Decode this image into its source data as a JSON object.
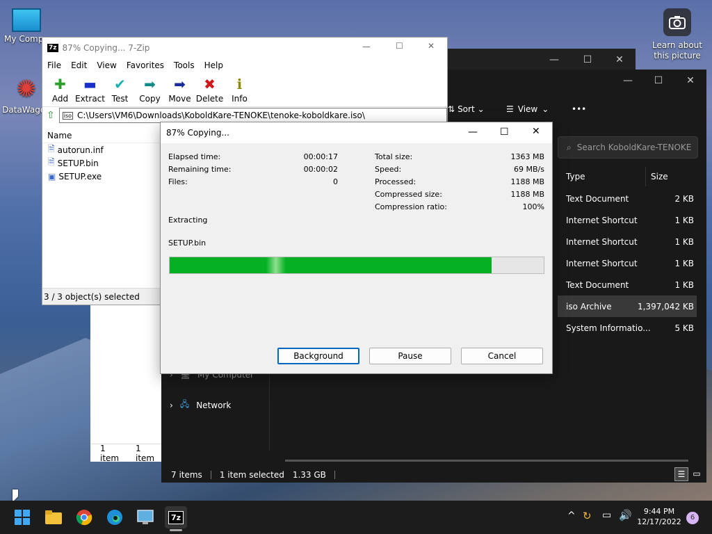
{
  "desktop": {
    "icons": [
      {
        "label": "My Compu"
      },
      {
        "label": "DataWagon"
      }
    ],
    "camera": {
      "label": "Learn about this picture"
    }
  },
  "zip": {
    "title": "87% Copying... 7-Zip",
    "menu": [
      "File",
      "Edit",
      "View",
      "Favorites",
      "Tools",
      "Help"
    ],
    "toolbar": [
      {
        "label": "Add",
        "glyph": "✚",
        "color": "#2aa02a"
      },
      {
        "label": "Extract",
        "glyph": "▬",
        "color": "#1a2fc8"
      },
      {
        "label": "Test",
        "glyph": "✔",
        "color": "#16b0b0"
      },
      {
        "label": "Copy",
        "glyph": "➡",
        "color": "#138a8a"
      },
      {
        "label": "Move",
        "glyph": "➡",
        "color": "#1a2a9a"
      },
      {
        "label": "Delete",
        "glyph": "✖",
        "color": "#d0181c"
      },
      {
        "label": "Info",
        "glyph": "ℹ",
        "color": "#8a8a00"
      }
    ],
    "address": "C:\\Users\\VM6\\Downloads\\KoboldKare-TENOKE\\tenoke-koboldkare.iso\\",
    "column_name": "Name",
    "files": [
      "autorun.inf",
      "SETUP.bin",
      "SETUP.exe"
    ],
    "status": "3 / 3 object(s) selected"
  },
  "dialog": {
    "title": "87% Copying...",
    "left": [
      {
        "label": "Elapsed time:",
        "value": "00:00:17"
      },
      {
        "label": "Remaining time:",
        "value": "00:00:02"
      },
      {
        "label": "Files:",
        "value": "0"
      }
    ],
    "right": [
      {
        "label": "Total size:",
        "value": "1363 MB"
      },
      {
        "label": "Speed:",
        "value": "69 MB/s"
      },
      {
        "label": "Processed:",
        "value": "1188 MB"
      },
      {
        "label": "Compressed size:",
        "value": "1188 MB"
      },
      {
        "label": "Compression ratio:",
        "value": "100%"
      }
    ],
    "operation": "Extracting",
    "current_file": "SETUP.bin",
    "progress": 0.86,
    "buttons": {
      "background": "Background",
      "pause": "Pause",
      "cancel": "Cancel"
    }
  },
  "explorer": {
    "sort": "Sort",
    "view": "View",
    "more": "•••",
    "search_placeholder": "Search KoboldKare-TENOKE",
    "col_type": "Type",
    "col_size": "Size",
    "rows": [
      {
        "type": "Text Document",
        "size": "2 KB"
      },
      {
        "type": "Internet Shortcut",
        "size": "1 KB"
      },
      {
        "type": "Internet Shortcut",
        "size": "1 KB"
      },
      {
        "type": "Internet Shortcut",
        "size": "1 KB"
      },
      {
        "type": "Text Document",
        "size": "1 KB"
      },
      {
        "type": "iso Archive",
        "size": "1,397,042 KB"
      },
      {
        "type": "System Informatio...",
        "size": "5 KB"
      }
    ],
    "nav": [
      "My Computer",
      "Network"
    ],
    "status_items": "7 items",
    "status_selected": "1 item selected",
    "status_size": "1.33 GB",
    "back_status_a": "1 item",
    "back_status_b": "1 item"
  },
  "taskbar": {
    "time": "9:44 PM",
    "date": "12/17/2022",
    "badge": "6"
  }
}
